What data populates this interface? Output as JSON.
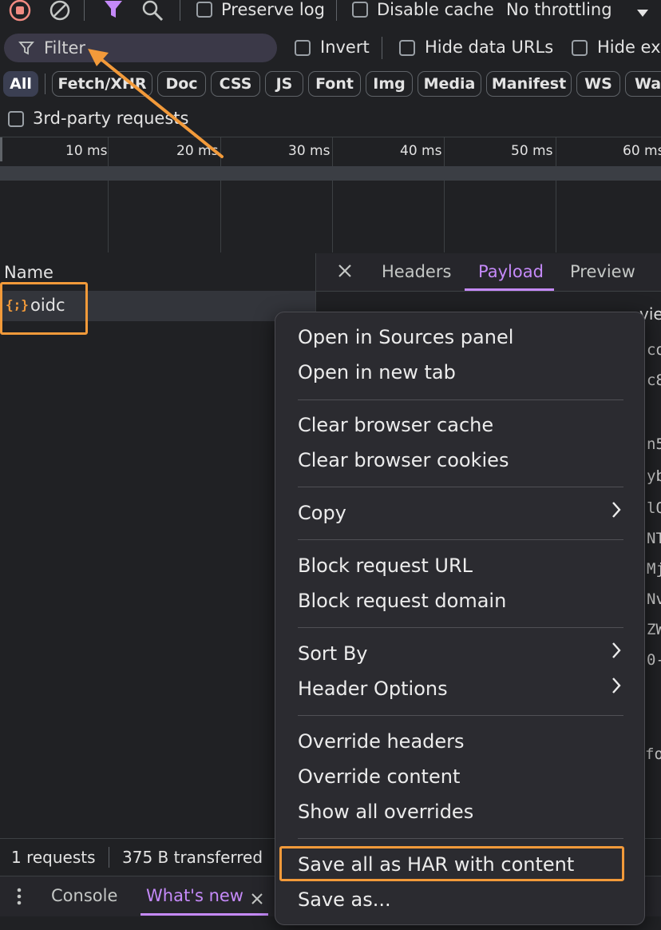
{
  "toolbar": {
    "preserve_log": "Preserve log",
    "disable_cache": "Disable cache",
    "throttling": "No throttling"
  },
  "filter_bar": {
    "filter_placeholder": "Filter",
    "invert": "Invert",
    "hide_data_urls": "Hide data URLs",
    "hide_ext": "Hide ext"
  },
  "type_chips": [
    "All",
    "Fetch/XHR",
    "Doc",
    "CSS",
    "JS",
    "Font",
    "Img",
    "Media",
    "Manifest",
    "WS",
    "Was"
  ],
  "third_party": "3rd-party requests",
  "timeline_ticks": [
    "10 ms",
    "20 ms",
    "30 ms",
    "40 ms",
    "50 ms",
    "60 ms"
  ],
  "request_list": {
    "header": "Name",
    "rows": [
      "oidc"
    ]
  },
  "details": {
    "tabs": [
      "Headers",
      "Payload",
      "Preview"
    ],
    "active_tab": "Payload",
    "behind_menu_fragments": [
      "vie",
      "co",
      "c8",
      "n5",
      "yb",
      "lQ",
      "NT",
      "Mj",
      "Nv",
      "ZW",
      "0-",
      "fo"
    ]
  },
  "status_bar": {
    "requests": "1 requests",
    "transferred": "375 B transferred"
  },
  "drawer": {
    "tabs": [
      "Console",
      "What's new"
    ]
  },
  "context_menu": {
    "open_sources": "Open in Sources panel",
    "open_new_tab": "Open in new tab",
    "clear_cache": "Clear browser cache",
    "clear_cookies": "Clear browser cookies",
    "copy": "Copy",
    "block_url": "Block request URL",
    "block_domain": "Block request domain",
    "sort_by": "Sort By",
    "header_options": "Header Options",
    "override_headers": "Override headers",
    "override_content": "Override content",
    "show_overrides": "Show all overrides",
    "save_har": "Save all as HAR with content",
    "save_as": "Save as..."
  },
  "colors": {
    "accent_purple": "#c58af9",
    "annotation_orange": "#f29a3a",
    "record_red": "#f28b82",
    "background": "#202124",
    "menu_background": "#2b2b30"
  }
}
